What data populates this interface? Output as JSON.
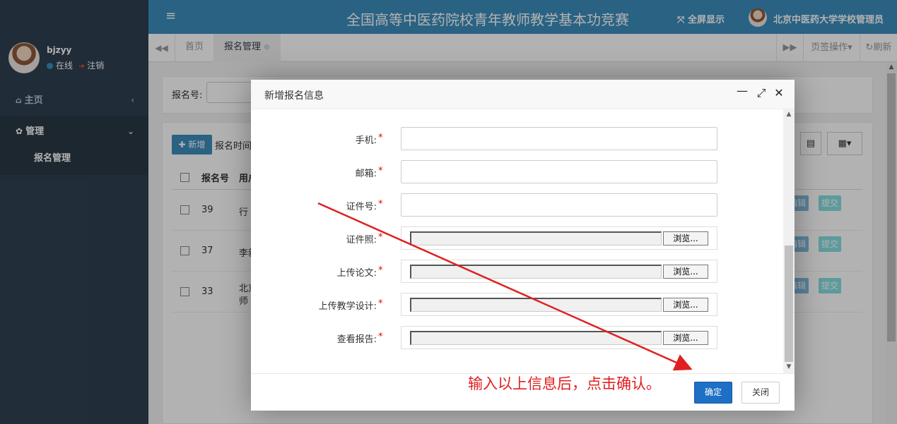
{
  "sidebar": {
    "user": {
      "name": "bjzyy",
      "status": "在线",
      "logout": "注销"
    },
    "menu": [
      {
        "icon": "home-icon",
        "label": "主页",
        "chevron": "‹"
      },
      {
        "icon": "gear-icon",
        "label": "管理",
        "chevron": "⌄"
      }
    ],
    "submenu": {
      "label": "报名管理"
    }
  },
  "header": {
    "menu_icon": "≡",
    "title": "全国高等中医药院校青年教师教学基本功竞赛",
    "fullscreen": "全屏显示",
    "admin_name": "北京中医药大学学校管理员"
  },
  "tabs": {
    "items": [
      {
        "label": "首页"
      },
      {
        "label": "报名管理",
        "close": "⊗"
      }
    ],
    "page_ops": "页签操作",
    "refresh": "刷新"
  },
  "page": {
    "search_label": "报名号:",
    "add_button": "新增",
    "filter_label": "报名时间",
    "columns": [
      "报名号",
      "用户"
    ],
    "rows": [
      {
        "id": "39",
        "name": "行"
      },
      {
        "id": "37",
        "name": "李新"
      },
      {
        "id": "33",
        "name_line1": "北京",
        "name_line2": "师"
      }
    ],
    "row_actions": {
      "edit": "编辑",
      "submit": "提交"
    }
  },
  "modal": {
    "title": "新增报名信息",
    "fields": [
      {
        "label": "手机:",
        "required": "*"
      },
      {
        "label": "邮箱:",
        "required": "*"
      },
      {
        "label": "证件号:",
        "required": "*"
      }
    ],
    "file_fields": [
      {
        "label": "证件照:",
        "required": "*",
        "browse": "浏览..."
      },
      {
        "label": "上传论文:",
        "required": "*",
        "browse": "浏览..."
      },
      {
        "label": "上传教学设计:",
        "required": "*",
        "browse": "浏览..."
      },
      {
        "label": "查看报告:",
        "required": "*",
        "browse": "浏览..."
      }
    ],
    "confirm": "确定",
    "close": "关闭"
  },
  "annotation": {
    "note": "输入以上信息后，点击确认。",
    "color": "#e02020"
  }
}
